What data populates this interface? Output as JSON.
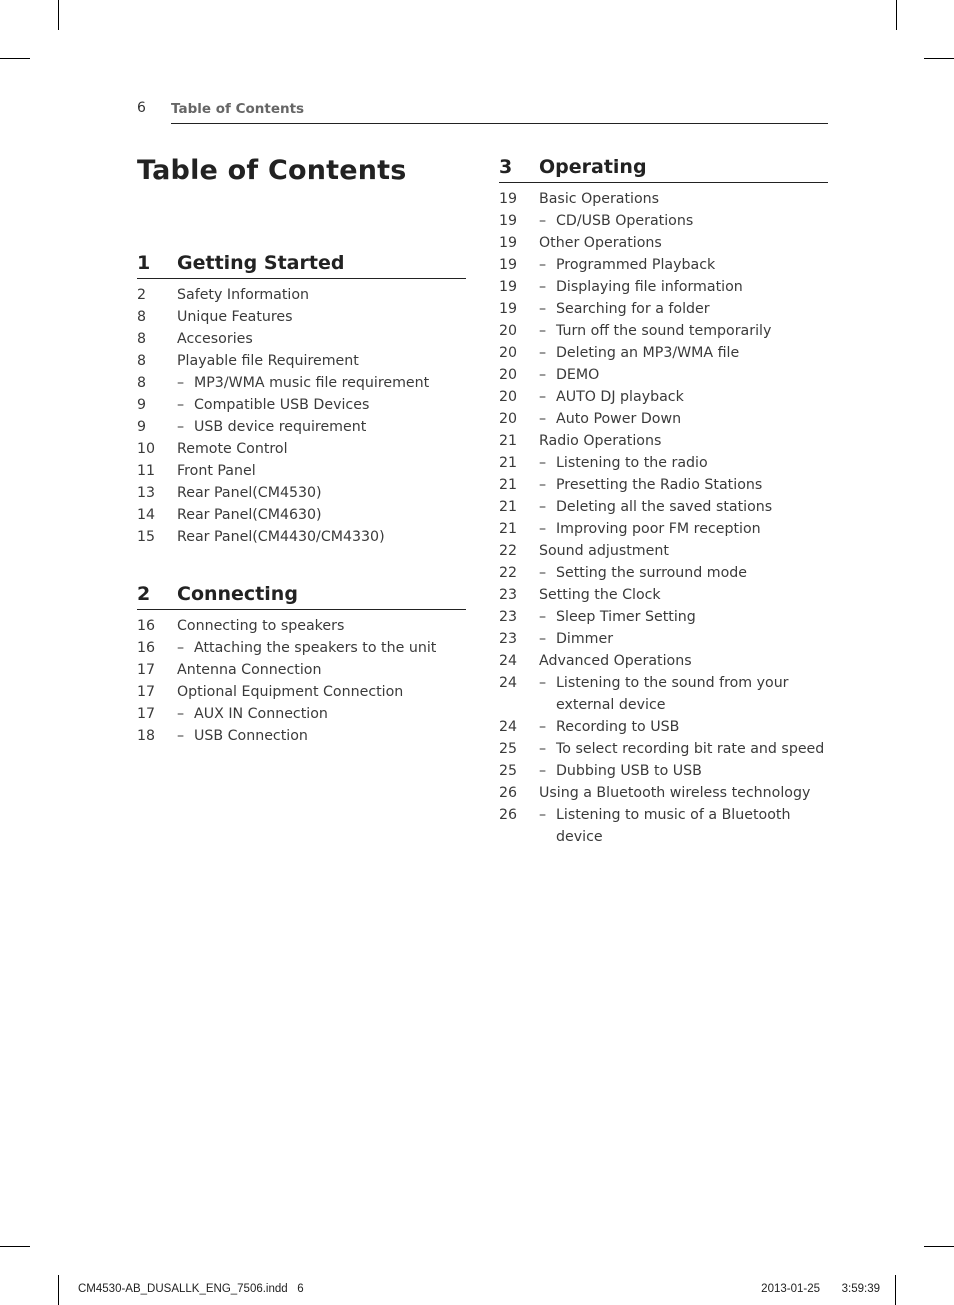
{
  "running_head": {
    "page_number": "6",
    "title": "Table of Contents"
  },
  "document_title": "Table of Contents",
  "sections": [
    {
      "number": "1",
      "title": "Getting Started",
      "entries": [
        {
          "page": "2",
          "text": "Safety Information",
          "sub": false
        },
        {
          "page": "8",
          "text": "Unique Features",
          "sub": false
        },
        {
          "page": "8",
          "text": "Accesories",
          "sub": false
        },
        {
          "page": "8",
          "text": "Playable file Requirement",
          "sub": false
        },
        {
          "page": "8",
          "text": "MP3/WMA music file requirement",
          "sub": true
        },
        {
          "page": "9",
          "text": "Compatible USB Devices",
          "sub": true
        },
        {
          "page": "9",
          "text": "USB device requirement",
          "sub": true
        },
        {
          "page": "10",
          "text": "Remote Control",
          "sub": false
        },
        {
          "page": "11",
          "text": "Front Panel",
          "sub": false
        },
        {
          "page": "13",
          "text": "Rear Panel(CM4530)",
          "sub": false
        },
        {
          "page": "14",
          "text": "Rear Panel(CM4630)",
          "sub": false
        },
        {
          "page": "15",
          "text": "Rear Panel(CM4430/CM4330)",
          "sub": false
        }
      ]
    },
    {
      "number": "2",
      "title": "Connecting",
      "entries": [
        {
          "page": "16",
          "text": "Connecting to speakers",
          "sub": false
        },
        {
          "page": "16",
          "text": "Attaching the speakers to the unit",
          "sub": true
        },
        {
          "page": "17",
          "text": "Antenna Connection",
          "sub": false
        },
        {
          "page": "17",
          "text": "Optional Equipment Connection",
          "sub": false
        },
        {
          "page": "17",
          "text": "AUX IN Connection",
          "sub": true
        },
        {
          "page": "18",
          "text": "USB Connection",
          "sub": true
        }
      ]
    },
    {
      "number": "3",
      "title": "Operating",
      "entries": [
        {
          "page": "19",
          "text": "Basic Operations",
          "sub": false
        },
        {
          "page": "19",
          "text": "CD/USB Operations",
          "sub": true
        },
        {
          "page": "19",
          "text": "Other Operations",
          "sub": false
        },
        {
          "page": "19",
          "text": "Programmed Playback",
          "sub": true
        },
        {
          "page": "19",
          "text": "Displaying file information",
          "sub": true
        },
        {
          "page": "19",
          "text": "Searching for a folder",
          "sub": true
        },
        {
          "page": "20",
          "text": "Turn off the sound temporarily",
          "sub": true
        },
        {
          "page": "20",
          "text": "Deleting an MP3/WMA file",
          "sub": true
        },
        {
          "page": "20",
          "text": "DEMO",
          "sub": true
        },
        {
          "page": "20",
          "text": "AUTO DJ playback",
          "sub": true
        },
        {
          "page": "20",
          "text": "Auto Power Down",
          "sub": true
        },
        {
          "page": "21",
          "text": "Radio Operations",
          "sub": false
        },
        {
          "page": "21",
          "text": "Listening to the radio",
          "sub": true
        },
        {
          "page": "21",
          "text": "Presetting the Radio Stations",
          "sub": true
        },
        {
          "page": "21",
          "text": "Deleting all the saved stations",
          "sub": true
        },
        {
          "page": "21",
          "text": "Improving poor FM reception",
          "sub": true
        },
        {
          "page": "22",
          "text": "Sound adjustment",
          "sub": false
        },
        {
          "page": "22",
          "text": "Setting the surround mode",
          "sub": true
        },
        {
          "page": "23",
          "text": "Setting the Clock",
          "sub": false
        },
        {
          "page": "23",
          "text": "Sleep Timer Setting",
          "sub": true
        },
        {
          "page": "23",
          "text": "Dimmer",
          "sub": true
        },
        {
          "page": "24",
          "text": "Advanced Operations",
          "sub": false
        },
        {
          "page": "24",
          "text": "Listening to the sound from your external device",
          "sub": true
        },
        {
          "page": "24",
          "text": "Recording to USB",
          "sub": true
        },
        {
          "page": "25",
          "text": "To select recording bit rate and speed",
          "sub": true
        },
        {
          "page": "25",
          "text": "Dubbing USB to USB",
          "sub": true
        },
        {
          "page": "26",
          "text": "Using a Bluetooth wireless technology",
          "sub": false
        },
        {
          "page": "26",
          "text": "Listening to music of a Bluetooth device",
          "sub": true
        }
      ]
    }
  ],
  "dash_glyph": "–",
  "slug": {
    "file": "CM4530-AB_DUSALLK_ENG_7506.indd   6",
    "date": "2013-01-25",
    "time": "3:59:39"
  }
}
